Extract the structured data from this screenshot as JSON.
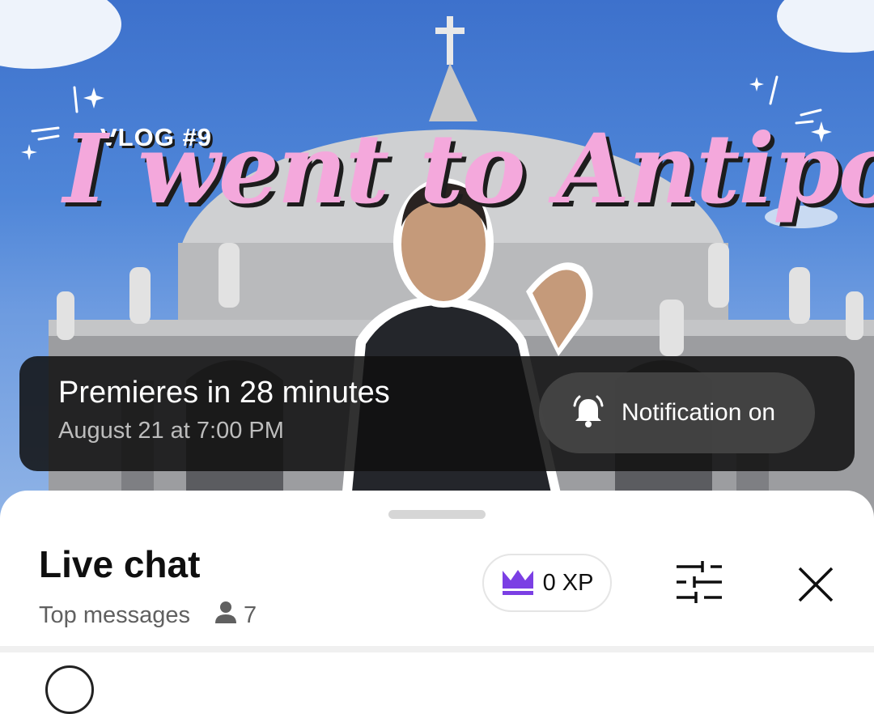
{
  "thumbnail": {
    "vlog_tag": "VLOG #9",
    "title": "I went to Antipolo",
    "colors": {
      "sky": "#4f86d8",
      "title_pink": "#f4a8dc"
    }
  },
  "premiere": {
    "title": "Premieres in 28 minutes",
    "date": "August 21 at 7:00 PM",
    "notification_label": "Notification on",
    "notification_icon": "bell-ringing-icon"
  },
  "chat": {
    "title": "Live chat",
    "mode": "Top messages",
    "viewer_count": "7",
    "xp_label": "0 XP",
    "icons": {
      "viewers": "person-icon",
      "xp": "crown-icon",
      "settings": "sliders-icon",
      "close": "close-icon"
    },
    "colors": {
      "crown": "#7b3fe4"
    }
  }
}
